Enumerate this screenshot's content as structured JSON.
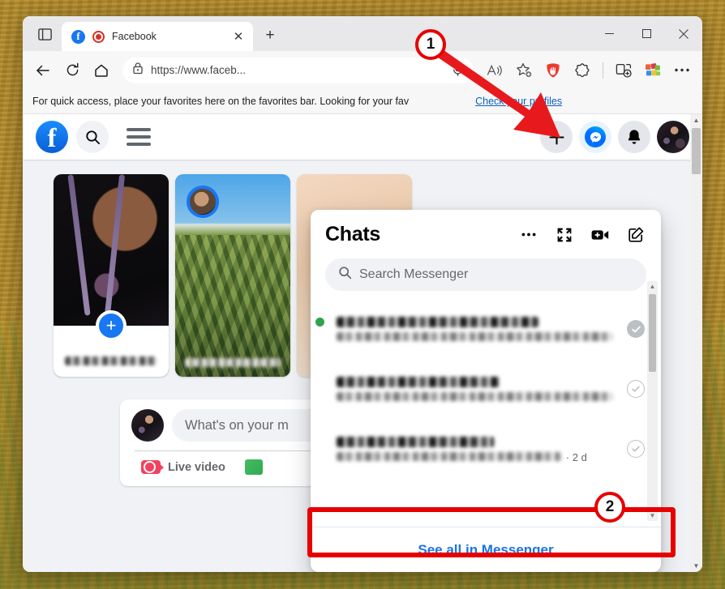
{
  "browser": {
    "tab": {
      "title": "Facebook",
      "favicon": "facebook-icon",
      "recording_indicator": "record-icon",
      "close_label": "✕"
    },
    "new_tab_label": "+",
    "window_controls": {
      "minimize": "—",
      "maximize": "☐",
      "close": "✕"
    },
    "nav": {
      "back": "back-arrow-icon",
      "refresh": "refresh-icon",
      "home": "home-icon"
    },
    "address_bar": {
      "lock": "lock-icon",
      "url": "https://www.faceb...",
      "mic": "microphone-icon",
      "read_aloud": "read-aloud-icon",
      "favorite": "add-favorite-icon"
    },
    "toolbar": {
      "adblock": "shield-icon",
      "copilot": "copilot-icon",
      "split_screen": "split-screen-icon",
      "collections": "collections-icon",
      "settings": "more-settings-icon"
    },
    "favorites_bar": {
      "message": "For quick access, place your favorites here on the favorites bar. Looking for your fav",
      "link": "Check your profiles"
    }
  },
  "facebook": {
    "header": {
      "logo": "facebook-logo",
      "search": "search-icon",
      "menu": "hamburger-menu-icon",
      "create": "plus-icon",
      "messenger": "messenger-icon",
      "notifications": "bell-icon",
      "account": "profile-avatar"
    },
    "stories": [
      {
        "type": "create",
        "label_redacted": true,
        "plus": "+"
      },
      {
        "type": "friend",
        "label_redacted": true
      },
      {
        "type": "friend",
        "label_redacted": true
      }
    ],
    "composer": {
      "placeholder": "What's on your m",
      "actions": [
        {
          "label": "Live video",
          "icon": "live-video-icon"
        },
        {
          "label": "",
          "icon": "photo-video-icon"
        }
      ]
    }
  },
  "chats_panel": {
    "title": "Chats",
    "header_actions": [
      {
        "name": "options",
        "icon": "ellipsis-icon",
        "glyph": "•••"
      },
      {
        "name": "expand",
        "icon": "expand-icon"
      },
      {
        "name": "new-video-call",
        "icon": "video-camera-plus-icon"
      },
      {
        "name": "new-message",
        "icon": "compose-icon"
      }
    ],
    "search": {
      "placeholder": "Search Messenger",
      "icon": "search-icon"
    },
    "rows": [
      {
        "name_redacted": true,
        "snippet_redacted": true,
        "time": "",
        "online": true,
        "status": "filled",
        "status_icon": "check-circle-filled-icon"
      },
      {
        "name_redacted": true,
        "snippet_redacted": true,
        "time": "",
        "online": false,
        "status": "outline",
        "status_icon": "check-circle-outline-icon"
      },
      {
        "name_redacted": true,
        "snippet_redacted": true,
        "time": "· 2 d",
        "online": false,
        "status": "outline",
        "status_icon": "check-circle-outline-icon"
      }
    ],
    "see_all_label": "See all in Messenger"
  },
  "annotations": [
    {
      "id": 1,
      "label": "1",
      "target": "messenger-icon",
      "shape": "arrow"
    },
    {
      "id": 2,
      "label": "2",
      "target": "see-all-in-messenger-button",
      "shape": "rectangle"
    }
  ],
  "colors": {
    "accent_blue": "#1877f2",
    "link_blue": "#1b74e4",
    "annotation_red": "#e60000",
    "online_green": "#31a24c",
    "live_red": "#f3425f",
    "fb_bg": "#f0f2f5"
  }
}
